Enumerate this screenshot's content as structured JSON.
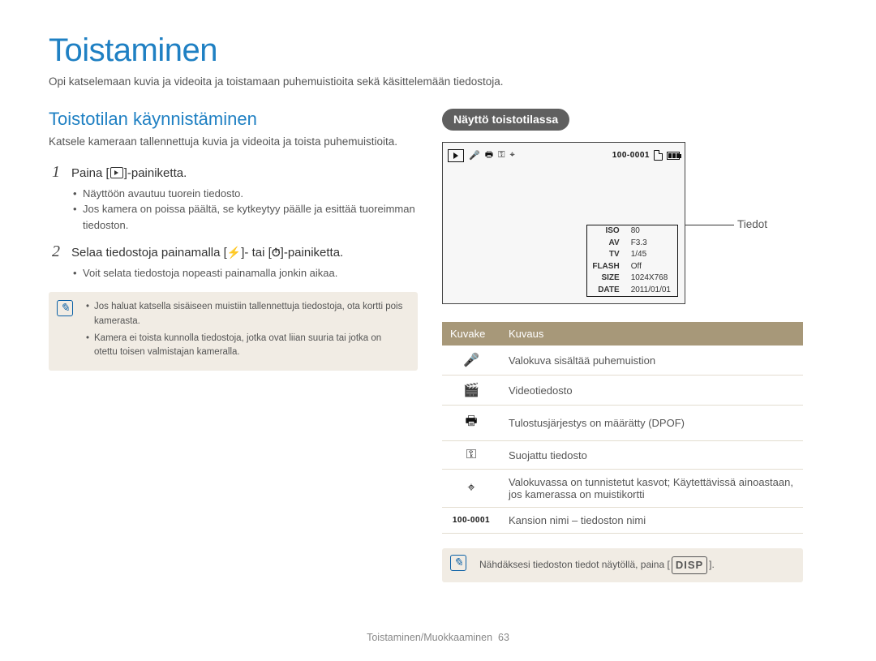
{
  "page": {
    "title": "Toistaminen",
    "intro": "Opi katselemaan kuvia ja videoita ja toistamaan puhemuistioita sekä käsittelemään tiedostoja."
  },
  "section": {
    "heading": "Toistotilan käynnistäminen",
    "subtext": "Katsele kameraan tallennettuja kuvia ja videoita ja toista puhemuistioita."
  },
  "steps": [
    {
      "title_pre": "Paina [",
      "title_post": "]-painiketta.",
      "bullets": [
        "Näyttöön avautuu tuorein tiedosto.",
        "Jos kamera on poissa päältä, se kytkeytyy päälle ja esittää tuoreimman tiedoston."
      ]
    },
    {
      "title_pre": "Selaa tiedostoja painamalla [",
      "title_mid": "]- tai [",
      "title_post": "]-painiketta.",
      "bullets": [
        "Voit selata tiedostoja nopeasti painamalla jonkin aikaa."
      ]
    }
  ],
  "note1": {
    "items": [
      "Jos haluat katsella sisäiseen muistiin tallennettuja tiedostoja, ota kortti pois kamerasta.",
      "Kamera ei toista kunnolla tiedostoja, jotka ovat liian suuria tai jotka on otettu toisen valmistajan kameralla."
    ]
  },
  "right": {
    "badge": "Näyttö toistotilassa",
    "callout": "Tiedot"
  },
  "lcd": {
    "file_counter": "100-0001",
    "info": {
      "ISO": "80",
      "AV": "F3.3",
      "TV": "1/45",
      "FLASH": "Off",
      "SIZE": "1024X768",
      "DATE": "2011/01/01"
    }
  },
  "icon_table": {
    "headers": {
      "icon": "Kuvake",
      "desc": "Kuvaus"
    },
    "rows": [
      {
        "glyph": "🎤",
        "name": "voice-memo-icon",
        "desc": "Valokuva sisältää puhemuistion"
      },
      {
        "glyph": "🎬",
        "name": "video-file-icon",
        "desc": "Videotiedosto"
      },
      {
        "glyph": "🖶",
        "name": "print-order-icon",
        "desc": "Tulostusjärjestys on määrätty (DPOF)"
      },
      {
        "glyph": "⚿",
        "name": "protected-icon",
        "desc": "Suojattu tiedosto"
      },
      {
        "glyph": "⌖",
        "name": "face-detect-icon",
        "desc": "Valokuvassa on tunnistetut kasvot; Käytettävissä ainoastaan, jos kamerassa on muistikortti"
      },
      {
        "glyph": "100-0001",
        "name": "folder-file-label",
        "desc": "Kansion nimi – tiedoston nimi",
        "textIcon": true
      }
    ]
  },
  "note2": {
    "text_pre": "Nähdäksesi tiedoston tiedot näytöllä, paina [",
    "disp": "DISP",
    "text_post": "]."
  },
  "footer": {
    "section": "Toistaminen/Muokkaaminen",
    "page": "63"
  }
}
